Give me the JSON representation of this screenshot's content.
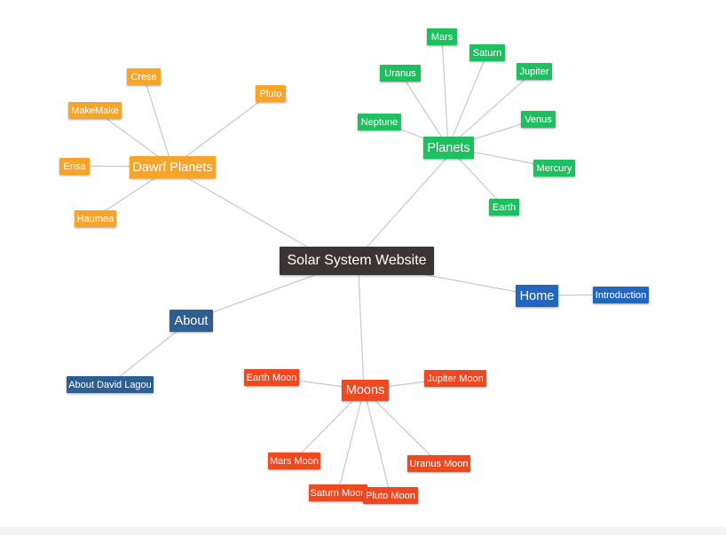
{
  "colors": {
    "root": "#3a3433",
    "dwarf": "#f6a52a",
    "planets": "#1fbf5f",
    "home": "#2166c0",
    "about": "#2f5e93",
    "moons": "#f0481f",
    "edge": "#c8c8c8"
  },
  "root": {
    "label": "Solar System Website"
  },
  "branches": {
    "dwarf": {
      "label": "Dawrf Planets",
      "children": [
        "Crese",
        "Pluto",
        "MakeMake",
        "Erisa",
        "Haumea"
      ]
    },
    "planets": {
      "label": "Planets",
      "children": [
        "Mars",
        "Uranus",
        "Saturn",
        "Jupiter",
        "Neptune",
        "Venus",
        "Mercury",
        "Earth"
      ]
    },
    "home": {
      "label": "Home",
      "children": [
        "Introduction"
      ]
    },
    "about": {
      "label": "About",
      "children": [
        "About David Lagou"
      ]
    },
    "moons": {
      "label": "Moons",
      "children": [
        "Earth Moon",
        "Jupiter Moon",
        "Mars Moon",
        "Uranus Moon",
        "Saturn Moon",
        "Pluto Moon"
      ]
    }
  }
}
